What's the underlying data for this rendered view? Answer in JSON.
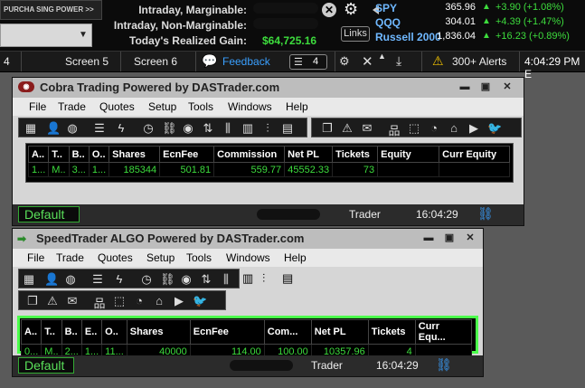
{
  "header": {
    "purchasing_power_label": "PURCHA SING POWER >>",
    "intraday_marginable_label": "Intraday, Marginable:",
    "intraday_nonmarginable_label": "Intraday, Non-Marginable:",
    "realized_gain_label": "Today's Realized Gain:",
    "realized_gain_value": "$64,725.16",
    "links_label": "Links",
    "tickers": [
      {
        "symbol": "SPY",
        "price": "365.96",
        "change": "+3.90 (+1.08%)"
      },
      {
        "symbol": "QQQ",
        "price": "304.01",
        "change": "+4.39 (+1.47%)"
      },
      {
        "symbol": "Russell 2000",
        "price": "1,836.04",
        "change": "+16.23 (+0.89%)"
      }
    ]
  },
  "tabbar": {
    "tabs": [
      "4",
      "Screen 5",
      "Screen 6"
    ],
    "feedback": "Feedback",
    "window_count": "4",
    "alerts": "300+ Alerts",
    "time": "4:04:29 PM E"
  },
  "window1": {
    "title": "Cobra Trading Powered by DASTrader.com",
    "menu": [
      "File",
      "Trade",
      "Quotes",
      "Setup",
      "Tools",
      "Windows",
      "Help"
    ],
    "columns": [
      "A..",
      "T..",
      "B..",
      "O..",
      "Shares",
      "EcnFee",
      "Commission",
      "Net PL",
      "Tickets",
      "Equity",
      "Curr Equity"
    ],
    "row": [
      "1...",
      "M..",
      "3...",
      "1...",
      "185344",
      "501.81",
      "559.77",
      "45552.33",
      "73",
      "",
      ""
    ],
    "default_label": "Default",
    "trader_label": "Trader",
    "time": "16:04:29"
  },
  "window2": {
    "title": "SpeedTrader ALGO Powered by DASTrader.com",
    "menu": [
      "File",
      "Trade",
      "Quotes",
      "Setup",
      "Tools",
      "Windows",
      "Help"
    ],
    "columns": [
      "A..",
      "T..",
      "B..",
      "E..",
      "O..",
      "Shares",
      "EcnFee",
      "Com...",
      "Net PL",
      "Tickets",
      "Curr Equ..."
    ],
    "row": [
      "0...",
      "M..",
      "2...",
      "1...",
      "11...",
      "40000",
      "114.00",
      "100.00",
      "10357.96",
      "4",
      ""
    ],
    "default_label": "Default",
    "trader_label": "Trader",
    "time": "16:04:29"
  },
  "colors": {
    "green": "#3ddc3d",
    "accent_blue": "#3aa0ff",
    "ticker_blue": "#6fb8ff"
  }
}
